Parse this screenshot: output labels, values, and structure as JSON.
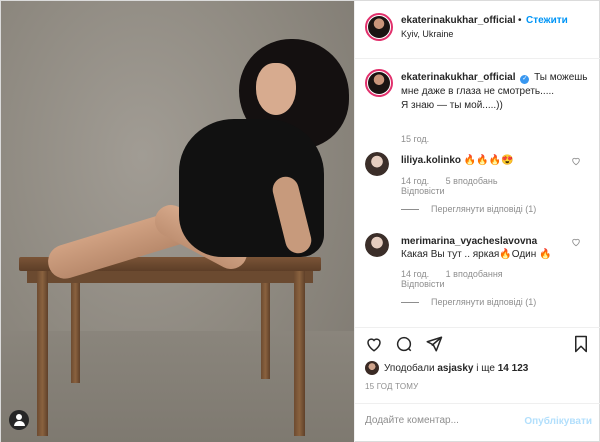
{
  "post": {
    "username": "ekaterinakukhar_official",
    "follow_separator": "•",
    "follow_label": "Стежити",
    "location": "Kyiv, Ukraine",
    "caption": {
      "username": "ekaterinakukhar_official",
      "verified_glyph": "✓",
      "line1": "Ты можешь мне даже в глаза не смотреть.....",
      "line2": "Я знаю — ты мой.....))",
      "time": "15 год."
    },
    "comments": [
      {
        "username": "liliya.kolinko",
        "text": "🔥🔥🔥😍",
        "time": "14 год.",
        "likes": "5 вподобань",
        "reply": "Відповісти",
        "view_replies": "Переглянути відповіді (1)"
      },
      {
        "username": "merimarina_vyacheslavovna",
        "text": "Какая Вы тут .. яркая🔥Один 🔥",
        "time": "14 год.",
        "likes": "1 вподобання",
        "reply": "Відповісти",
        "view_replies": "Переглянути відповіді (1)"
      }
    ],
    "likes": {
      "prefix": "Уподобали",
      "user": "asjasky",
      "middle": "і ще",
      "count": "14 123"
    },
    "time_ago": "15 ГОД ТОМУ",
    "add_comment_placeholder": "Додайте коментар...",
    "publish_label": "Опублікувати"
  },
  "colors": {
    "accent": "#0095f6",
    "verified": "#3897f0",
    "muted": "#8e8e8e",
    "publish_disabled": "#b2dffc",
    "story_ring": "#e1306c"
  },
  "icons": [
    "heart-icon",
    "comment-icon",
    "share-icon",
    "bookmark-icon",
    "user-tag-icon",
    "verified-badge-icon"
  ]
}
